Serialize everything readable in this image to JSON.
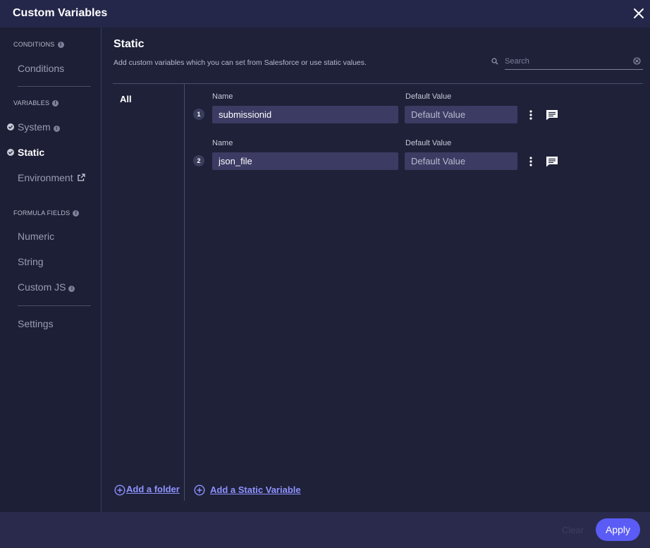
{
  "window": {
    "title": "Custom Variables"
  },
  "sidebar": {
    "conditions_section": "CONDITIONS",
    "conditions_item": "Conditions",
    "variables_section": "VARIABLES",
    "system_item": "System",
    "static_item": "Static",
    "environment_item": "Environment",
    "formula_section": "FORMULA FIELDS",
    "numeric_item": "Numeric",
    "string_item": "String",
    "customjs_item": "Custom JS",
    "settings_item": "Settings"
  },
  "main": {
    "title": "Static",
    "description": "Add custom variables which you can set from Salesforce or use static values.",
    "search": {
      "placeholder": "Search"
    },
    "folders": {
      "all_label": "All",
      "add_folder": "Add a folder"
    },
    "variables": [
      {
        "index": "1",
        "name_label": "Name",
        "name_value": "submissionid",
        "default_label": "Default Value",
        "default_placeholder": "Default Value"
      },
      {
        "index": "2",
        "name_label": "Name",
        "name_value": "json_file",
        "default_label": "Default Value",
        "default_placeholder": "Default Value"
      }
    ],
    "add_variable": "Add a Static Variable"
  },
  "footer": {
    "clear_label": "Clear",
    "apply_label": "Apply"
  },
  "colors": {
    "accent": "#5a5cf5",
    "link": "#8f93ff",
    "background": "#1e2138",
    "field": "#3c3b63"
  }
}
